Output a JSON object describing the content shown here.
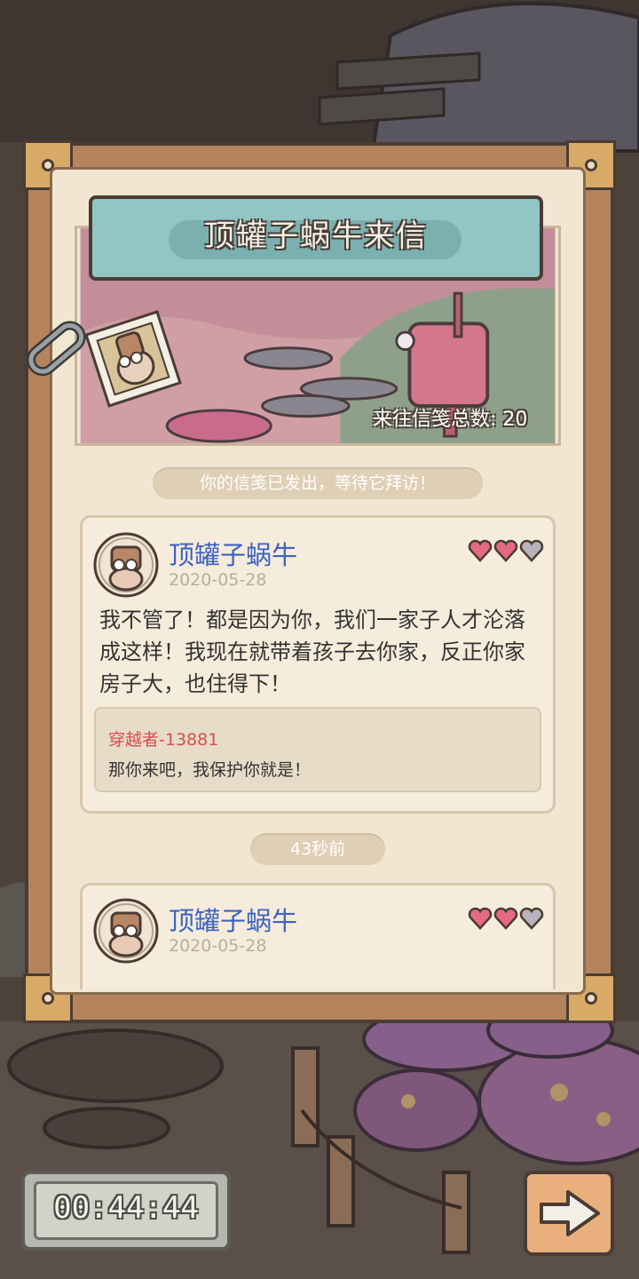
{
  "header": {
    "title": "顶罐子蜗牛来信",
    "total_letters": "来往信笺总数: 20"
  },
  "status": {
    "sent_notice": "你的信笺已发出，等待它拜访！",
    "time_ago": "43秒前"
  },
  "letters": [
    {
      "sender": "顶罐子蜗牛",
      "date": "2020-05-28",
      "hearts_filled": 2,
      "hearts_total": 3,
      "body_lines": [
        "我不管了！都是因为你，我们一家子人才沦落",
        "成这样！我现在就带着孩子去你家，反正你家",
        "房子大，也住得下！"
      ],
      "reply_user": "穿越者-13881",
      "reply_text": "那你来吧，我保护你就是！"
    },
    {
      "sender": "顶罐子蜗牛",
      "date": "2020-05-28",
      "hearts_filled": 2,
      "hearts_total": 3
    }
  ],
  "timer": {
    "value": "00:44:44"
  },
  "icons": {
    "heart_filled": "heart-filled-icon",
    "heart_empty": "heart-empty-icon",
    "next": "arrow-right-icon",
    "stamp": "snail-stamp-icon",
    "mailbox": "mailbox-icon",
    "clip": "paperclip-icon"
  },
  "colors": {
    "name_blue": "#3c62c3",
    "reply_red": "#d94e4e",
    "heart_pink": "#e46a82",
    "heart_gray": "#b8b3bd",
    "banner_teal": "#92c5c4"
  }
}
